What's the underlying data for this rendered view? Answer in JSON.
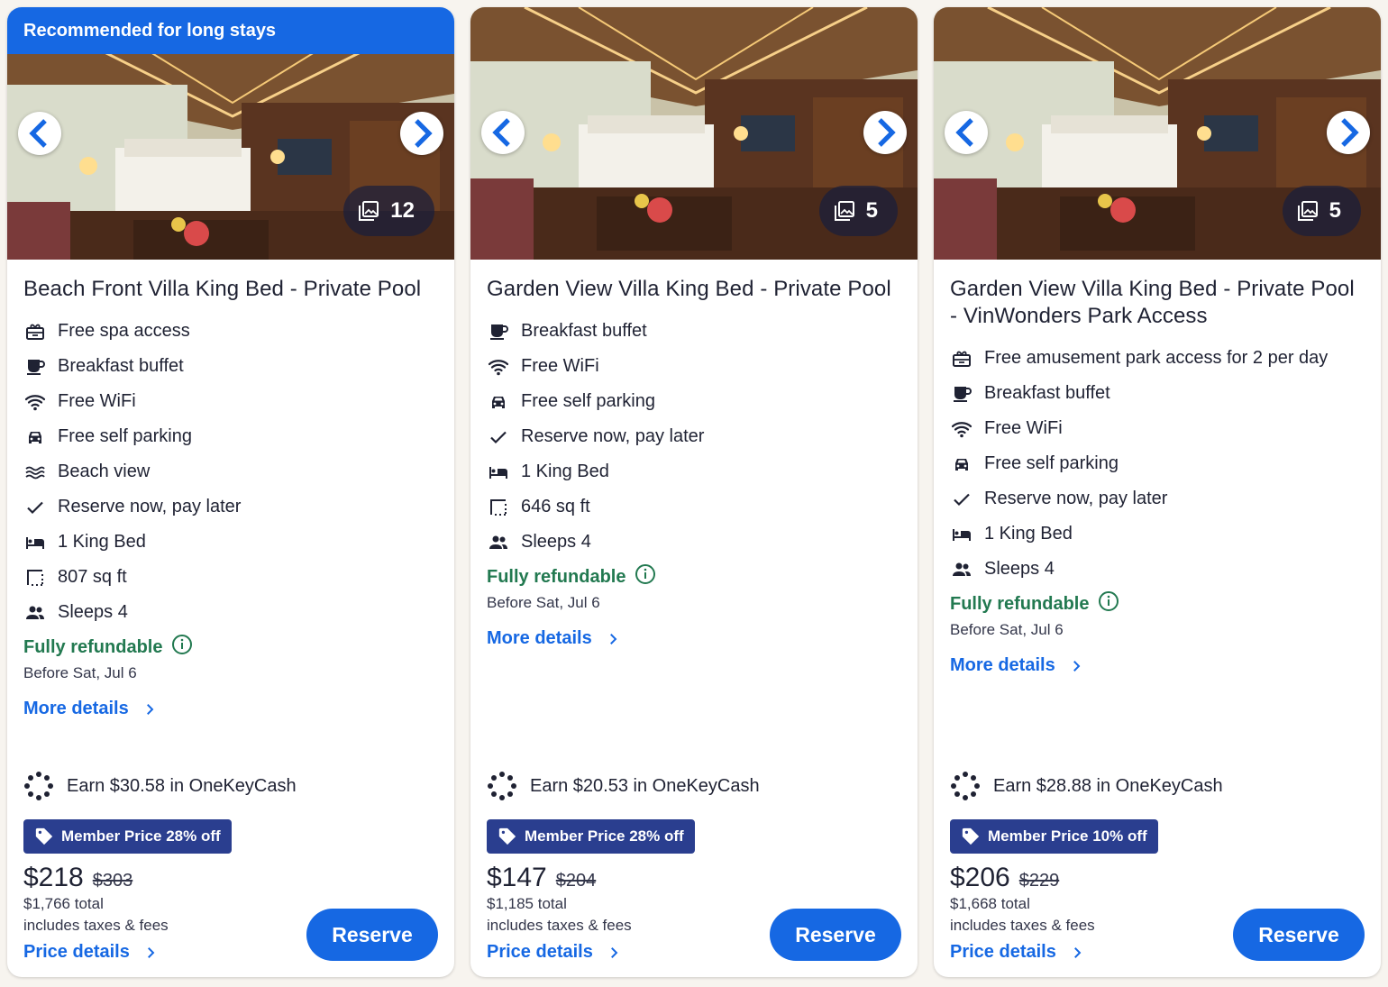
{
  "colors": {
    "accent": "#1668e3",
    "badge": "#2a3e8f",
    "refund": "#227950",
    "text": "#1f2233"
  },
  "cards": [
    {
      "banner": "Recommended for long stays",
      "photo_count": "12",
      "title": "Beach Front Villa King Bed - Private Pool",
      "amenities": [
        {
          "icon": "spa-icon",
          "text": "Free spa access"
        },
        {
          "icon": "coffee-icon",
          "text": "Breakfast buffet"
        },
        {
          "icon": "wifi-icon",
          "text": "Free WiFi"
        },
        {
          "icon": "car-icon",
          "text": "Free self parking"
        },
        {
          "icon": "waves-icon",
          "text": "Beach view"
        },
        {
          "icon": "check-icon",
          "text": "Reserve now, pay later"
        },
        {
          "icon": "bed-icon",
          "text": "1 King Bed"
        },
        {
          "icon": "area-icon",
          "text": "807 sq ft"
        },
        {
          "icon": "people-icon",
          "text": "Sleeps 4"
        }
      ],
      "refund": "Fully refundable",
      "refund_before": "Before Sat, Jul 6",
      "more_details": "More details",
      "cash": "Earn $30.58 in OneKeyCash",
      "badge": "Member Price 28% off",
      "price": "$218",
      "old_price": "$303",
      "total": "$1,766 total",
      "taxes": "includes taxes & fees",
      "price_details": "Price details",
      "reserve": "Reserve"
    },
    {
      "banner": "",
      "photo_count": "5",
      "title": "Garden View Villa King Bed - Private Pool",
      "amenities": [
        {
          "icon": "coffee-icon",
          "text": "Breakfast buffet"
        },
        {
          "icon": "wifi-icon",
          "text": "Free WiFi"
        },
        {
          "icon": "car-icon",
          "text": "Free self parking"
        },
        {
          "icon": "check-icon",
          "text": "Reserve now, pay later"
        },
        {
          "icon": "bed-icon",
          "text": "1 King Bed"
        },
        {
          "icon": "area-icon",
          "text": "646 sq ft"
        },
        {
          "icon": "people-icon",
          "text": "Sleeps 4"
        }
      ],
      "refund": "Fully refundable",
      "refund_before": "Before Sat, Jul 6",
      "more_details": "More details",
      "cash": "Earn $20.53 in OneKeyCash",
      "badge": "Member Price 28% off",
      "price": "$147",
      "old_price": "$204",
      "total": "$1,185 total",
      "taxes": "includes taxes & fees",
      "price_details": "Price details",
      "reserve": "Reserve"
    },
    {
      "banner": "",
      "photo_count": "5",
      "title": "Garden View Villa King Bed - Private Pool - VinWonders Park Access",
      "amenities": [
        {
          "icon": "spa-icon",
          "text": "Free amusement park access for 2 per day"
        },
        {
          "icon": "coffee-icon",
          "text": "Breakfast buffet"
        },
        {
          "icon": "wifi-icon",
          "text": "Free WiFi"
        },
        {
          "icon": "car-icon",
          "text": "Free self parking"
        },
        {
          "icon": "check-icon",
          "text": "Reserve now, pay later"
        },
        {
          "icon": "bed-icon",
          "text": "1 King Bed"
        },
        {
          "icon": "people-icon",
          "text": "Sleeps 4"
        }
      ],
      "refund": "Fully refundable",
      "refund_before": "Before Sat, Jul 6",
      "more_details": "More details",
      "cash": "Earn $28.88 in OneKeyCash",
      "badge": "Member Price 10% off",
      "price": "$206",
      "old_price": "$229",
      "total": "$1,668 total",
      "taxes": "includes taxes & fees",
      "price_details": "Price details",
      "reserve": "Reserve"
    }
  ]
}
